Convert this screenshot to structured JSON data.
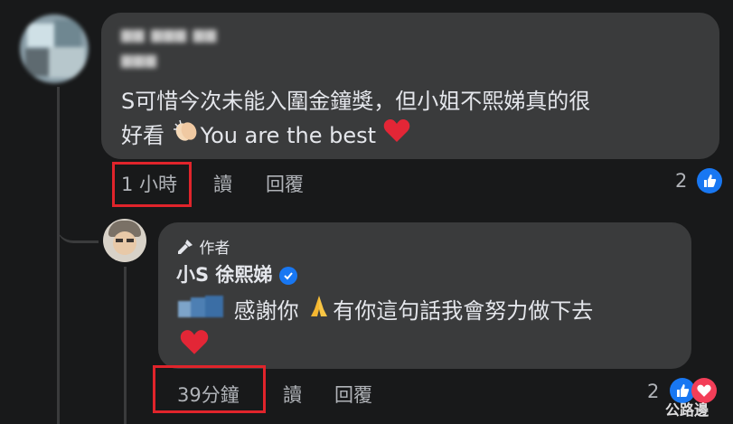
{
  "comment": {
    "text_line1": "S可惜今次未能入圍金鐘獎，但小姐不熙娣真的很",
    "text_line2_before": "好看",
    "text_line2_after": "You are the best",
    "clap_emoji_name": "clapping-hands-icon",
    "heart_emoji_name": "red-heart-icon",
    "time": "1 小時",
    "read_label": "讀",
    "reply_label": "回覆",
    "reaction_count": "2"
  },
  "reply": {
    "author_badge": "作者",
    "author_name": "小S 徐熙娣",
    "text_line1_before": "感謝你",
    "text_line1_after": "有你這句話我會努力做下去",
    "pray_emoji_name": "folded-hands-icon",
    "heart_emoji_name": "red-heart-icon",
    "time": "39分鐘",
    "read_label": "讀",
    "reply_label": "回覆",
    "reaction_count": "2"
  },
  "watermark": "公路邊",
  "colors": {
    "background": "#18191a",
    "bubble": "#3a3b3c",
    "text": "#e4e6eb",
    "muted": "#b0b3b8",
    "like_blue": "#1877f2",
    "highlight_red": "#e0242b"
  }
}
